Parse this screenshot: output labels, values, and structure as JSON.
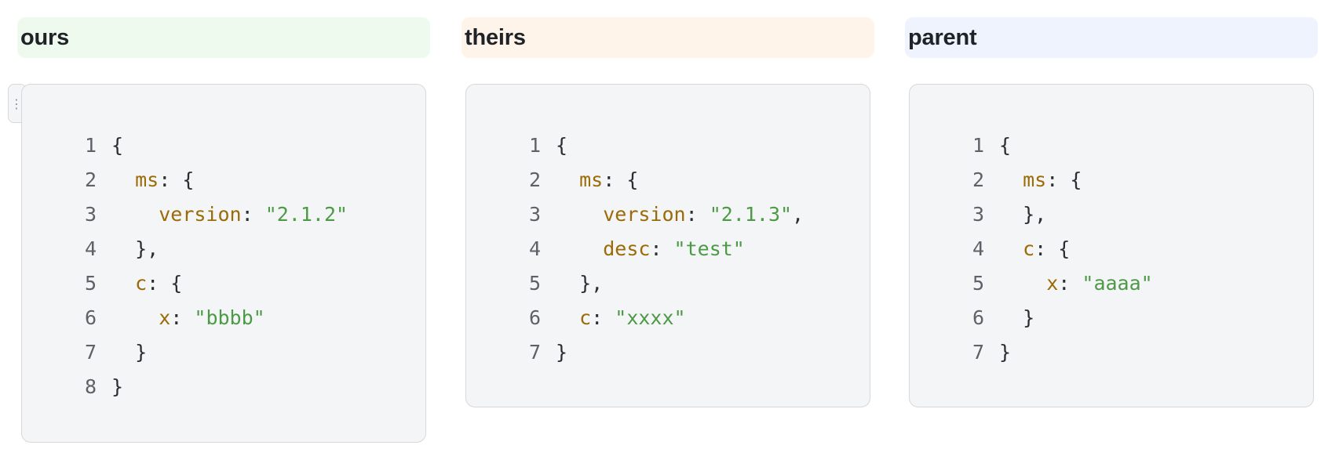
{
  "panels": [
    {
      "id": "ours",
      "title": "ours",
      "accent": "#effaee",
      "lines": [
        {
          "no": "1",
          "indent": "",
          "key": "",
          "sep": "",
          "str": "",
          "tail": "{"
        },
        {
          "no": "2",
          "indent": "  ",
          "key": "ms",
          "sep": ": ",
          "str": "",
          "tail": "{"
        },
        {
          "no": "3",
          "indent": "    ",
          "key": "version",
          "sep": ": ",
          "str": "\"2.1.2\"",
          "tail": ""
        },
        {
          "no": "4",
          "indent": "  ",
          "key": "",
          "sep": "",
          "str": "",
          "tail": "},"
        },
        {
          "no": "5",
          "indent": "  ",
          "key": "c",
          "sep": ": ",
          "str": "",
          "tail": "{"
        },
        {
          "no": "6",
          "indent": "    ",
          "key": "x",
          "sep": ": ",
          "str": "\"bbbb\"",
          "tail": ""
        },
        {
          "no": "7",
          "indent": "  ",
          "key": "",
          "sep": "",
          "str": "",
          "tail": "}"
        },
        {
          "no": "8",
          "indent": "",
          "key": "",
          "sep": "",
          "str": "",
          "tail": "}"
        }
      ]
    },
    {
      "id": "theirs",
      "title": "theirs",
      "accent": "#fef4ea",
      "lines": [
        {
          "no": "1",
          "indent": "",
          "key": "",
          "sep": "",
          "str": "",
          "tail": "{"
        },
        {
          "no": "2",
          "indent": "  ",
          "key": "ms",
          "sep": ": ",
          "str": "",
          "tail": "{"
        },
        {
          "no": "3",
          "indent": "    ",
          "key": "version",
          "sep": ": ",
          "str": "\"2.1.3\"",
          "tail": ","
        },
        {
          "no": "4",
          "indent": "    ",
          "key": "desc",
          "sep": ": ",
          "str": "\"test\"",
          "tail": ""
        },
        {
          "no": "5",
          "indent": "  ",
          "key": "",
          "sep": "",
          "str": "",
          "tail": "},"
        },
        {
          "no": "6",
          "indent": "  ",
          "key": "c",
          "sep": ": ",
          "str": "\"xxxx\"",
          "tail": ""
        },
        {
          "no": "7",
          "indent": "",
          "key": "",
          "sep": "",
          "str": "",
          "tail": "}"
        }
      ]
    },
    {
      "id": "parent",
      "title": "parent",
      "accent": "#eef3fe",
      "lines": [
        {
          "no": "1",
          "indent": "",
          "key": "",
          "sep": "",
          "str": "",
          "tail": "{"
        },
        {
          "no": "2",
          "indent": "  ",
          "key": "ms",
          "sep": ": ",
          "str": "",
          "tail": "{"
        },
        {
          "no": "3",
          "indent": "  ",
          "key": "",
          "sep": "",
          "str": "",
          "tail": "},"
        },
        {
          "no": "4",
          "indent": "  ",
          "key": "c",
          "sep": ": ",
          "str": "",
          "tail": "{"
        },
        {
          "no": "5",
          "indent": "    ",
          "key": "x",
          "sep": ": ",
          "str": "\"aaaa\"",
          "tail": ""
        },
        {
          "no": "6",
          "indent": "  ",
          "key": "",
          "sep": "",
          "str": "",
          "tail": "}"
        },
        {
          "no": "7",
          "indent": "",
          "key": "",
          "sep": "",
          "str": "",
          "tail": "}"
        }
      ]
    }
  ],
  "side_handle": {
    "icon": "drag-handle-icon",
    "glyph": "⋮"
  },
  "colors": {
    "key": "#9a6b06",
    "string": "#4d9a46",
    "punctuation": "#2b2d31",
    "line_number": "#5e6167",
    "code_bg": "#f4f5f7",
    "code_border": "#d6d8dc"
  }
}
